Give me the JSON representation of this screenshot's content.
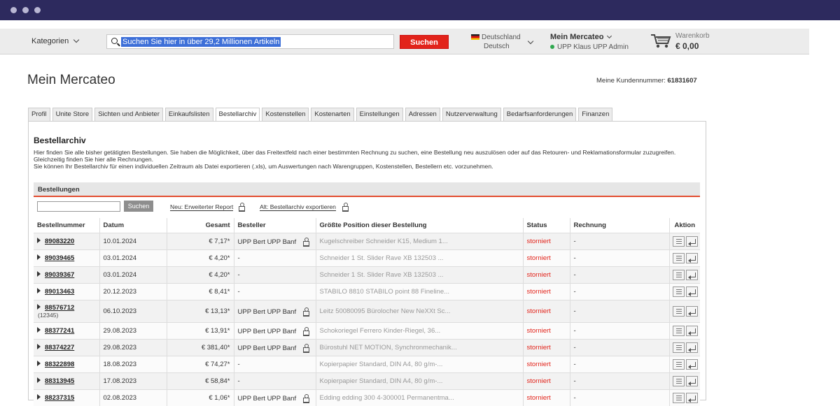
{
  "header": {
    "categories_label": "Kategorien",
    "search_text": "Suchen Sie hier in über 29,2 Millionen Artikeln",
    "search_button": "Suchen",
    "country": "Deutschland",
    "language": "Deutsch",
    "account_title": "Mein Mercateo",
    "account_user": "UPP Klaus UPP Admin",
    "cart_label": "Warenkorb",
    "cart_amount": "€ 0,00"
  },
  "page": {
    "title": "Mein Mercateo",
    "customer_label": "Meine Kundennummer:",
    "customer_number": "61831607"
  },
  "tabs": [
    "Profil",
    "Unite Store",
    "Sichten und Anbieter",
    "Einkaufslisten",
    "Bestellarchiv",
    "Kostenstellen",
    "Kostenarten",
    "Einstellungen",
    "Adressen",
    "Nutzerverwaltung",
    "Bedarfsanforderungen",
    "Finanzen"
  ],
  "active_tab": "Bestellarchiv",
  "section": {
    "title": "Bestellarchiv",
    "desc1": "Hier finden Sie alle bisher getätigten Bestellungen. Sie haben die Möglichkeit, über das Freitextfeld nach einer bestimmten Rechnung zu suchen, eine Bestellung neu auszulösen oder auf das Retouren- und Reklamationsformular zuzugreifen. Gleichzeitig finden Sie hier alle Rechnungen.",
    "desc2": "Sie können Ihr Bestellarchiv für einen individuellen Zeitraum als Datei exportieren (.xls), um Auswertungen nach Warengruppen, Kostenstellen, Bestellern etc. vorzunehmen."
  },
  "orders": {
    "box_title": "Bestellungen",
    "search_button": "Suchen",
    "report_link": "Neu: Erweiterter Report",
    "export_link": "Alt: Bestellarchiv exportieren",
    "columns": [
      "Bestellnummer",
      "Datum",
      "Gesamt",
      "Besteller",
      "Größte Position dieser Bestellung",
      "Status",
      "Rechnung",
      "Aktion"
    ],
    "rows": [
      {
        "nr": "89083220",
        "sub": "",
        "date": "10.01.2024",
        "total": "€ 7,17*",
        "buyer": "UPP Bert UPP Banf",
        "position": "Kugelschreiber Schneider K15, Medium 1...",
        "status": "storniert",
        "invoice": "-"
      },
      {
        "nr": "89039465",
        "sub": "",
        "date": "03.01.2024",
        "total": "€ 4,20*",
        "buyer": "-",
        "position": "Schneider 1 St. Slider Rave XB 132503 ...",
        "status": "storniert",
        "invoice": "-"
      },
      {
        "nr": "89039367",
        "sub": "",
        "date": "03.01.2024",
        "total": "€ 4,20*",
        "buyer": "-",
        "position": "Schneider 1 St. Slider Rave XB 132503 ...",
        "status": "storniert",
        "invoice": "-"
      },
      {
        "nr": "89013463",
        "sub": "",
        "date": "20.12.2023",
        "total": "€ 8,41*",
        "buyer": "-",
        "position": "STABILO 8810 STABILO point 88 Fineline...",
        "status": "storniert",
        "invoice": "-"
      },
      {
        "nr": "88576712",
        "sub": "(12345)",
        "date": "06.10.2023",
        "total": "€ 13,13*",
        "buyer": "UPP Bert UPP Banf",
        "position": "Leitz 50080095 Bürolocher New NeXXt Sc...",
        "status": "storniert",
        "invoice": "-"
      },
      {
        "nr": "88377241",
        "sub": "",
        "date": "29.08.2023",
        "total": "€ 13,91*",
        "buyer": "UPP Bert UPP Banf",
        "position": "Schokoriegel Ferrero Kinder-Riegel, 36...",
        "status": "storniert",
        "invoice": "-"
      },
      {
        "nr": "88374227",
        "sub": "",
        "date": "29.08.2023",
        "total": "€ 381,40*",
        "buyer": "UPP Bert UPP Banf",
        "position": "Bürostuhl NET MOTION, Synchronmechanik...",
        "status": "storniert",
        "invoice": "-"
      },
      {
        "nr": "88322898",
        "sub": "",
        "date": "18.08.2023",
        "total": "€ 74,27*",
        "buyer": "-",
        "position": "Kopierpapier Standard, DIN A4, 80 g/m-...",
        "status": "storniert",
        "invoice": "-"
      },
      {
        "nr": "88313945",
        "sub": "",
        "date": "17.08.2023",
        "total": "€ 58,84*",
        "buyer": "-",
        "position": "Kopierpapier Standard, DIN A4, 80 g/m-...",
        "status": "storniert",
        "invoice": "-"
      },
      {
        "nr": "88237315",
        "sub": "",
        "date": "02.08.2023",
        "total": "€ 1,06*",
        "buyer": "UPP Bert UPP Banf",
        "position": "Edding edding 300 4-300001 Permanentma...",
        "status": "storniert",
        "invoice": "-"
      }
    ]
  }
}
